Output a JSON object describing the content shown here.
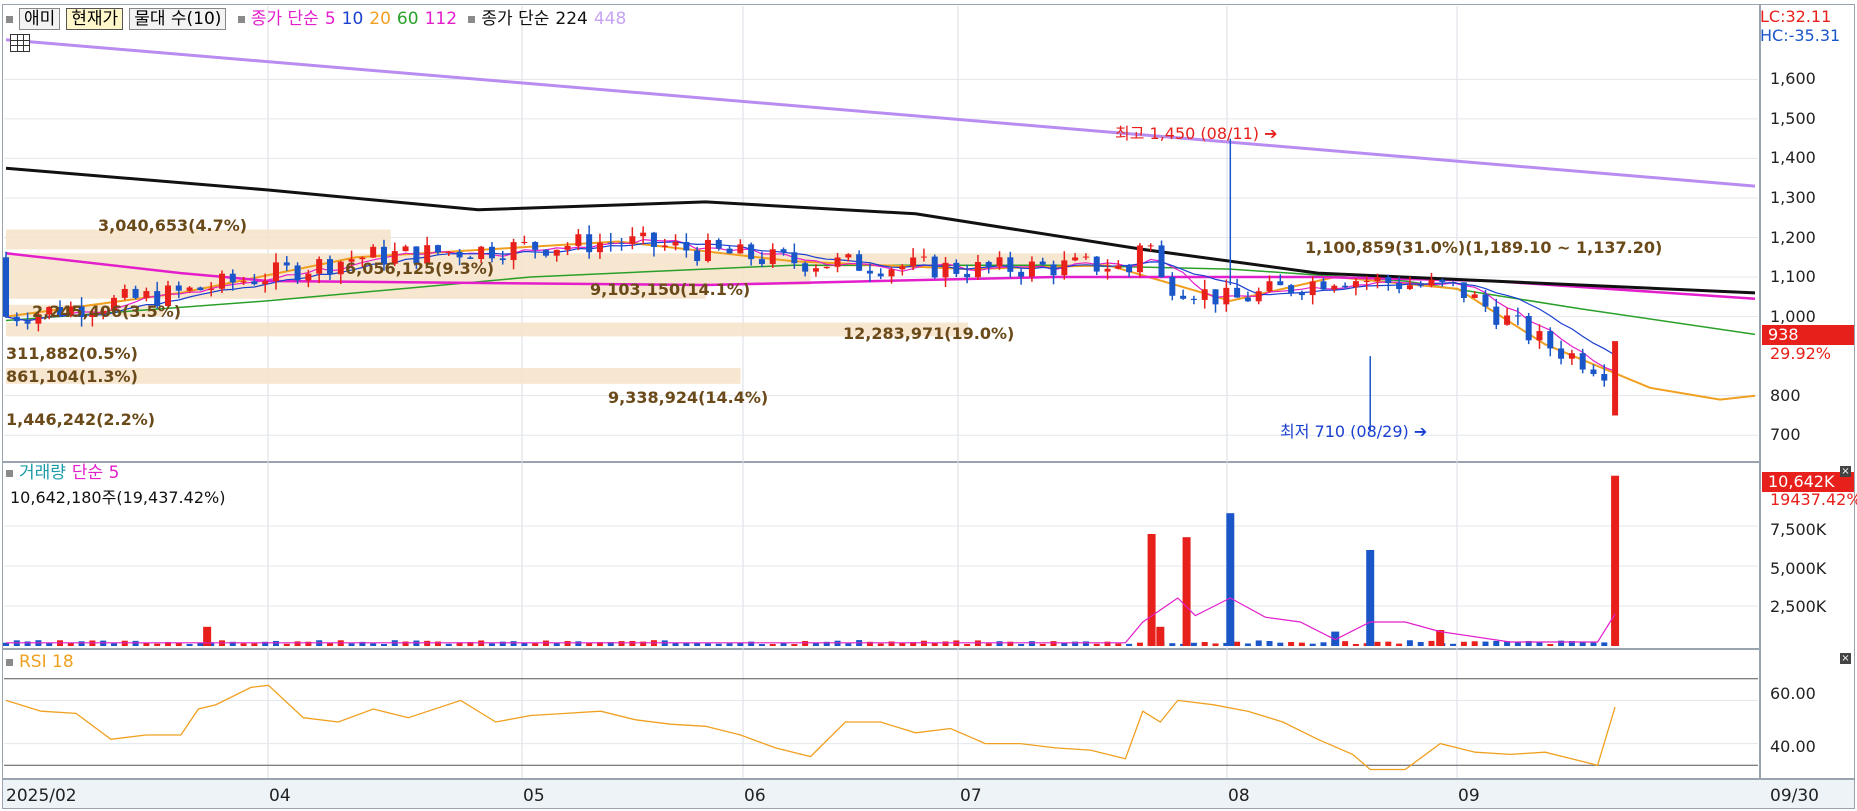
{
  "toolbar": {
    "buttons": [
      "애미",
      "현재가",
      "물대 수(10)"
    ],
    "price_legend": {
      "label": "종가 단순",
      "periods": [
        "5",
        "10",
        "20",
        "60",
        "112"
      ],
      "label2": "종가 단순",
      "periods2": [
        "224",
        "448"
      ]
    }
  },
  "colors": {
    "up": "#e8201c",
    "down": "#1a56c8",
    "ma5": "#e31ecb",
    "ma10": "#1a3fd1",
    "ma20": "#f0a020",
    "ma60": "#2aa02a",
    "ma112": "#e31ecb",
    "ma224": "#111111",
    "ma448": "#b88cf0",
    "vol_ma": "#e31ecb",
    "rsi": "#f0a020",
    "profile": "#f7e3c8"
  },
  "right_axis": {
    "lc": "LC:32.11",
    "hc": "HC:-35.31",
    "price_ticks": [
      "1,600",
      "1,500",
      "1,400",
      "1,300",
      "1,200",
      "1,100",
      "1,000",
      "800",
      "700"
    ],
    "current_price": "938",
    "current_change": "29.92%",
    "volume_ticks": [
      "7,500K",
      "5,000K",
      "2,500K"
    ],
    "volume_current": "10,642K",
    "volume_pct": "19437.42%",
    "rsi_ticks": [
      "60.00",
      "40.00"
    ]
  },
  "annotations": {
    "high": "최고 1,450 (08/11)",
    "low": "최저 710 (08/29)",
    "profile_labels": [
      "3,040,653(4.7%)",
      "1,100,859(31.0%)(1,189.10 ~ 1,137.20)",
      "6,056,125(9.3%)",
      "9,103,150(14.1%)",
      "2,245,406(3.5%)",
      "12,283,971(19.0%)",
      "311,882(0.5%)",
      "861,104(1.3%)",
      "9,338,924(14.4%)",
      "1,446,242(2.2%)"
    ]
  },
  "volume_panel": {
    "title": "거래량",
    "ma_label": "단순 5",
    "info": "10,642,180주(19,437.42%)"
  },
  "rsi_panel": {
    "title": "RSI 18"
  },
  "x_axis": {
    "labels": [
      "2025/02",
      "04",
      "05",
      "06",
      "07",
      "08",
      "09"
    ],
    "end_label": "09/30"
  },
  "chart_data": {
    "type": "candlestick",
    "x": [
      "2025/02",
      "04",
      "05",
      "06",
      "07",
      "08",
      "09",
      "09/30"
    ],
    "price_range": [
      650,
      1750
    ],
    "y_ticks": [
      700,
      800,
      1000,
      1100,
      1200,
      1300,
      1400,
      1500,
      1600
    ],
    "series": [
      {
        "name": "종가 단순 5"
      },
      {
        "name": "10"
      },
      {
        "name": "20"
      },
      {
        "name": "60"
      },
      {
        "name": "112"
      },
      {
        "name": "224"
      },
      {
        "name": "448"
      }
    ],
    "ma448": [
      [
        0,
        1700
      ],
      [
        100,
        1330
      ]
    ],
    "ma224": [
      [
        0,
        1375
      ],
      [
        15,
        1320
      ],
      [
        27,
        1270
      ],
      [
        40,
        1290
      ],
      [
        52,
        1260
      ],
      [
        65,
        1170
      ],
      [
        75,
        1110
      ],
      [
        90,
        1080
      ],
      [
        100,
        1060
      ]
    ],
    "ma112": [
      [
        0,
        1160
      ],
      [
        10,
        1110
      ],
      [
        15,
        1090
      ],
      [
        40,
        1080
      ],
      [
        60,
        1100
      ],
      [
        75,
        1100
      ],
      [
        85,
        1090
      ],
      [
        100,
        1045
      ]
    ],
    "ma60": [
      [
        0,
        990
      ],
      [
        15,
        1040
      ],
      [
        30,
        1100
      ],
      [
        45,
        1130
      ],
      [
        60,
        1130
      ],
      [
        70,
        1120
      ],
      [
        80,
        1090
      ],
      [
        90,
        1020
      ],
      [
        100,
        955
      ]
    ],
    "ma20": [
      [
        0,
        1000
      ],
      [
        10,
        1060
      ],
      [
        20,
        1150
      ],
      [
        35,
        1190
      ],
      [
        45,
        1140
      ],
      [
        55,
        1120
      ],
      [
        63,
        1130
      ],
      [
        70,
        1040
      ],
      [
        76,
        1100
      ],
      [
        83,
        1070
      ],
      [
        88,
        930
      ],
      [
        94,
        820
      ],
      [
        98,
        790
      ],
      [
        100,
        800
      ]
    ],
    "high": 1450,
    "high_date": "08/11",
    "low": 710,
    "low_date": "08/29",
    "current": 938,
    "change_pct": 29.92,
    "volume": {
      "unit": "shares",
      "ticks": [
        2500000,
        5000000,
        7500000
      ],
      "last": 10642180,
      "spikes": [
        {
          "pos": 65.5,
          "value": 7000000,
          "up": true
        },
        {
          "pos": 66.0,
          "value": 1200000,
          "up": true
        },
        {
          "pos": 67.5,
          "value": 6800000,
          "up": true
        },
        {
          "pos": 70.0,
          "value": 8300000,
          "up": false
        },
        {
          "pos": 78.0,
          "value": 6000000,
          "up": false
        },
        {
          "pos": 11.5,
          "value": 1200000,
          "up": true
        },
        {
          "pos": 76.0,
          "value": 900000,
          "up": false
        },
        {
          "pos": 82.0,
          "value": 1000000,
          "up": true
        },
        {
          "pos": 92.0,
          "value": 10642180,
          "up": true
        }
      ]
    },
    "rsi": {
      "period": 18,
      "range": [
        25,
        75
      ],
      "ticks": [
        40,
        60
      ],
      "points": [
        [
          0,
          60
        ],
        [
          2,
          55
        ],
        [
          4,
          54
        ],
        [
          6,
          42
        ],
        [
          8,
          44
        ],
        [
          10,
          44
        ],
        [
          11,
          56
        ],
        [
          12,
          58
        ],
        [
          14,
          66
        ],
        [
          15,
          67
        ],
        [
          17,
          52
        ],
        [
          19,
          50
        ],
        [
          21,
          56
        ],
        [
          23,
          52
        ],
        [
          26,
          60
        ],
        [
          28,
          50
        ],
        [
          30,
          53
        ],
        [
          32,
          54
        ],
        [
          34,
          55
        ],
        [
          36,
          51
        ],
        [
          38,
          49
        ],
        [
          40,
          48
        ],
        [
          42,
          44
        ],
        [
          44,
          38
        ],
        [
          46,
          34
        ],
        [
          48,
          50
        ],
        [
          50,
          50
        ],
        [
          52,
          45
        ],
        [
          54,
          47
        ],
        [
          56,
          40
        ],
        [
          58,
          40
        ],
        [
          60,
          38
        ],
        [
          62,
          37
        ],
        [
          64,
          33
        ],
        [
          65,
          55
        ],
        [
          66,
          50
        ],
        [
          67,
          60
        ],
        [
          69,
          58
        ],
        [
          71,
          55
        ],
        [
          73,
          50
        ],
        [
          75,
          42
        ],
        [
          77,
          35
        ],
        [
          78,
          28
        ],
        [
          80,
          28
        ],
        [
          82,
          40
        ],
        [
          84,
          36
        ],
        [
          86,
          35
        ],
        [
          88,
          36
        ],
        [
          90,
          32
        ],
        [
          91,
          30
        ],
        [
          92,
          57
        ]
      ]
    }
  }
}
